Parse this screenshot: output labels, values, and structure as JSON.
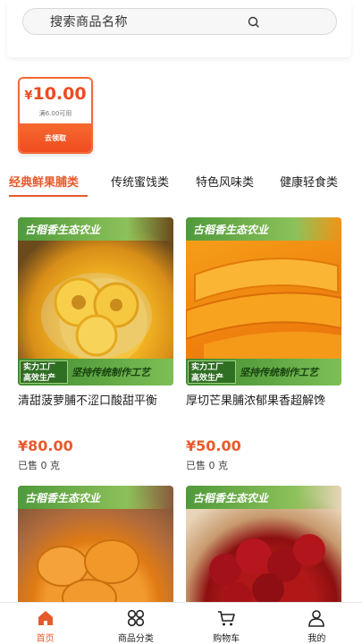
{
  "search": {
    "placeholder": "搜索商品名称"
  },
  "coupon": {
    "currency": "¥",
    "amount": "10.00",
    "condition": "满6.00可用",
    "button_label": "去领取"
  },
  "tabs": [
    {
      "label": "经典鲜果脯类",
      "active": true
    },
    {
      "label": "传统蜜饯类",
      "active": false
    },
    {
      "label": "特色风味类",
      "active": false
    },
    {
      "label": "健康轻食类",
      "active": false
    }
  ],
  "products": [
    {
      "banner": "古稻香生态农业",
      "tag": "实力工厂\n高效生产",
      "slogan": "坚持传统制作工艺",
      "title": "清甜菠萝脯不涩口酸甜平衡",
      "price": "¥80.00",
      "sold": "已售 0 克"
    },
    {
      "banner": "古稻香生态农业",
      "tag": "实力工厂\n高效生产",
      "slogan": "坚持传统制作工艺",
      "title": "厚切芒果脯浓郁果香超解馋",
      "price": "¥50.00",
      "sold": "已售 0 克"
    },
    {
      "banner": "古稻香生态农业"
    },
    {
      "banner": "古稻香生态农业"
    }
  ],
  "bottom_nav": [
    {
      "label": "首页",
      "icon": "home-icon",
      "active": true
    },
    {
      "label": "商品分类",
      "icon": "category-grid-icon",
      "active": false
    },
    {
      "label": "购物车",
      "icon": "cart-icon",
      "active": false
    },
    {
      "label": "我的",
      "icon": "user-icon",
      "active": false
    }
  ],
  "colors": {
    "accent": "#e85a2c",
    "banner_green": "#4f9a3a",
    "coupon_orange": "#f04c1f"
  }
}
